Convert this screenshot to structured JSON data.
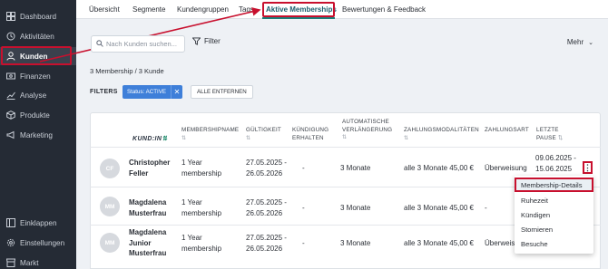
{
  "sidebar": {
    "items": [
      {
        "label": "Dashboard",
        "icon": "dashboard-icon"
      },
      {
        "label": "Aktivitäten",
        "icon": "activity-icon"
      },
      {
        "label": "Kunden",
        "icon": "user-icon"
      },
      {
        "label": "Finanzen",
        "icon": "finance-icon"
      },
      {
        "label": "Analyse",
        "icon": "chart-icon"
      },
      {
        "label": "Produkte",
        "icon": "box-icon"
      },
      {
        "label": "Marketing",
        "icon": "megaphone-icon"
      }
    ],
    "bottom": [
      {
        "label": "Einklappen",
        "icon": "collapse-icon"
      },
      {
        "label": "Einstellungen",
        "icon": "gear-icon"
      },
      {
        "label": "Markt",
        "icon": "store-icon"
      }
    ]
  },
  "tabs": [
    "Übersicht",
    "Segmente",
    "Kundengruppen",
    "Tags",
    "Aktive Memberships",
    "Bewertungen & Feedback"
  ],
  "search": {
    "placeholder": "Nach Kunden suchen..."
  },
  "filter_label": "Filter",
  "more_label": "Mehr",
  "count_text": "3 Membership / 3 Kunde",
  "filters": {
    "label": "FILTERS",
    "chip": "Status: ACTIVE",
    "remove_all": "ALLE ENTFERNEN"
  },
  "table": {
    "logo": {
      "text": "KUND:IN",
      "mark": "⇅"
    },
    "headers": {
      "membershipname": "MEMBERSHIPNAME",
      "gueltigkeit": "GÜLTIGKEIT",
      "kuendigung": [
        "KÜNDIGUNG",
        "ERHALTEN"
      ],
      "verlaengerung": [
        "AUTOMATISCHE",
        "VERLÄNGERUNG"
      ],
      "zahlungsmodalitaeten": "ZAHLUNGSMODALITÄTEN",
      "zahlungsart": "ZAHLUNGSART",
      "letzte_pause": [
        "LETZTE",
        "PAUSE"
      ]
    },
    "rows": [
      {
        "initials": "CF",
        "name": [
          "Christopher",
          "Feller"
        ],
        "membership": [
          "1 Year",
          "membership"
        ],
        "validity": [
          "27.05.2025 -",
          "26.05.2026"
        ],
        "kuendigung": "-",
        "renewal": "3 Monate",
        "payment": "alle 3 Monate 45,00 €",
        "method": "Überweisung",
        "pause": [
          "09.06.2025 -",
          "15.06.2025"
        ]
      },
      {
        "initials": "MM",
        "name": [
          "Magdalena",
          "Musterfrau"
        ],
        "membership": [
          "1 Year",
          "membership"
        ],
        "validity": [
          "27.05.2025 -",
          "26.05.2026"
        ],
        "kuendigung": "-",
        "renewal": "3 Monate",
        "payment": "alle 3 Monate 45,00 €",
        "method": "-",
        "pause": []
      },
      {
        "initials": "MM",
        "name": [
          "Magdalena",
          "Junior",
          "Musterfrau"
        ],
        "membership": [
          "1 Year",
          "membership"
        ],
        "validity": [
          "27.05.2025 -",
          "26.05.2026"
        ],
        "kuendigung": "-",
        "renewal": "3 Monate",
        "payment": "alle 3 Monate 45,00 €",
        "method": "Überweisung",
        "pause": []
      }
    ]
  },
  "context_menu": {
    "kebab": "⋮",
    "items": [
      "Membership-Details",
      "Ruhezeit",
      "Kündigen",
      "Stornieren",
      "Besuche"
    ]
  },
  "colors": {
    "sidebar": "#252b35",
    "accent": "#1d7f7a",
    "chip": "#3e7fd9",
    "highlight": "#c8102e"
  }
}
